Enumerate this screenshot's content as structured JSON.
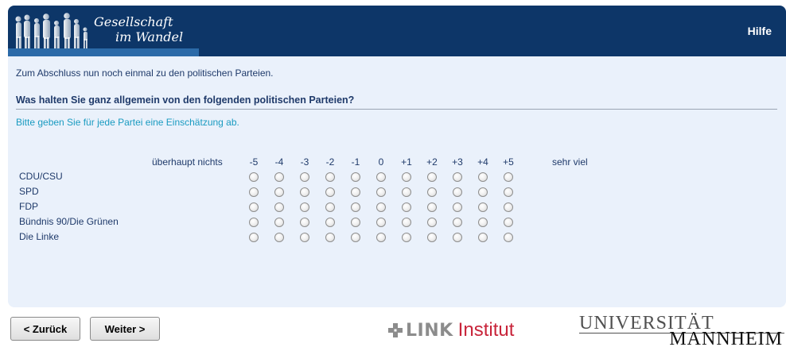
{
  "header": {
    "logo_line1": "Gesellschaft",
    "logo_line2": "im Wandel",
    "help_label": "Hilfe"
  },
  "survey": {
    "intro": "Zum Abschluss nun noch einmal zu den politischen Parteien.",
    "question": "Was halten Sie ganz allgemein von den folgenden politischen Parteien?",
    "instruction": "Bitte geben Sie für jede Partei eine Einschätzung ab.",
    "scale_low": "überhaupt nichts",
    "scale_high": "sehr viel",
    "scale_values": [
      "-5",
      "-4",
      "-3",
      "-2",
      "-1",
      "0",
      "+1",
      "+2",
      "+3",
      "+4",
      "+5"
    ],
    "parties": [
      "CDU/CSU",
      "SPD",
      "FDP",
      "Bündnis 90/Die Grünen",
      "Die Linke"
    ]
  },
  "nav": {
    "back_label": "< Zurück",
    "next_label": "Weiter >"
  },
  "footer": {
    "link_word": "LINK",
    "link_institut": "Institut",
    "uni_top": "UNIVERSITÄT",
    "uni_bottom": "MANNHEIM"
  },
  "colors": {
    "header_bg": "#0d3668",
    "panel_bg": "#eaf1fb",
    "text": "#1f3a6a",
    "instruction": "#1a9bc1",
    "link_red": "#c8243a"
  }
}
